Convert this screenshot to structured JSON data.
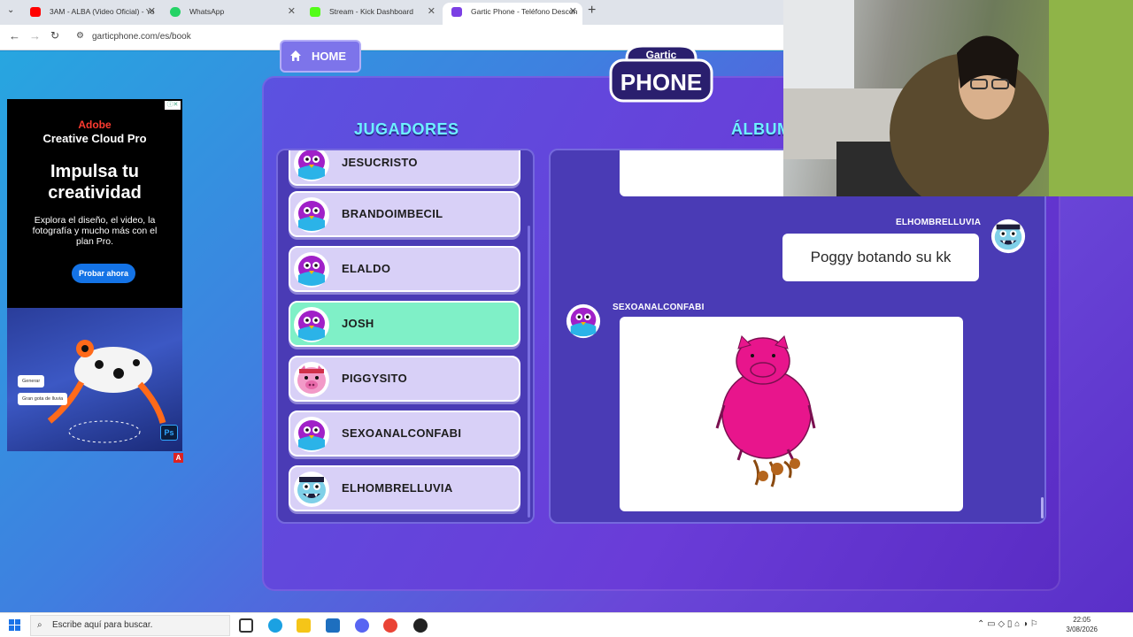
{
  "browser": {
    "tabs": [
      {
        "label": "3AM - ALBA (Video Oficial) - Yo",
        "color": "#ff0000"
      },
      {
        "label": "WhatsApp",
        "color": "#25d366"
      },
      {
        "label": "Stream - Kick Dashboard",
        "color": "#53fc18"
      },
      {
        "label": "Gartic Phone - Teléfono Descon",
        "color": "#7b3fe4",
        "active": true
      }
    ],
    "url": "garticphone.com/es/book"
  },
  "game": {
    "home_label": "HOME",
    "logo_top": "Gartic",
    "logo_bottom": "PHONE",
    "players_heading": "JUGADORES",
    "album_heading": "ÁLBUM",
    "players": [
      {
        "name": "JESUCRISTO",
        "avatar": "bird-avatar"
      },
      {
        "name": "BRANDOIMBECIL",
        "avatar": "bird-avatar"
      },
      {
        "name": "ELALDO",
        "avatar": "bird-avatar"
      },
      {
        "name": "JOSH",
        "avatar": "bird-avatar",
        "active": true
      },
      {
        "name": "PIGGYSITO",
        "avatar": "pig-avatar"
      },
      {
        "name": "SEXOANALCONFABI",
        "avatar": "bird-avatar"
      },
      {
        "name": "ELHOMBRELLUVIA",
        "avatar": "monster-avatar"
      }
    ],
    "album": {
      "guess_user": "ELHOMBRELLUVIA",
      "guess_text": "Poggy botando su kk",
      "draw_user": "SEXOANALCONFABI"
    }
  },
  "ad": {
    "brand": "Adobe",
    "product": "Creative Cloud Pro",
    "headline": "Impulsa tu creatividad",
    "body": "Explora el diseño, el video, la fotografía y mucho más con el plan Pro.",
    "cta": "Probar ahora",
    "chip1": "Generar",
    "chip2": "Gran gota de lluvia",
    "app_badge": "Ps"
  },
  "taskbar": {
    "search_placeholder": "Escribe aquí para buscar.",
    "time": "22:05",
    "date": "3/08/2026"
  }
}
